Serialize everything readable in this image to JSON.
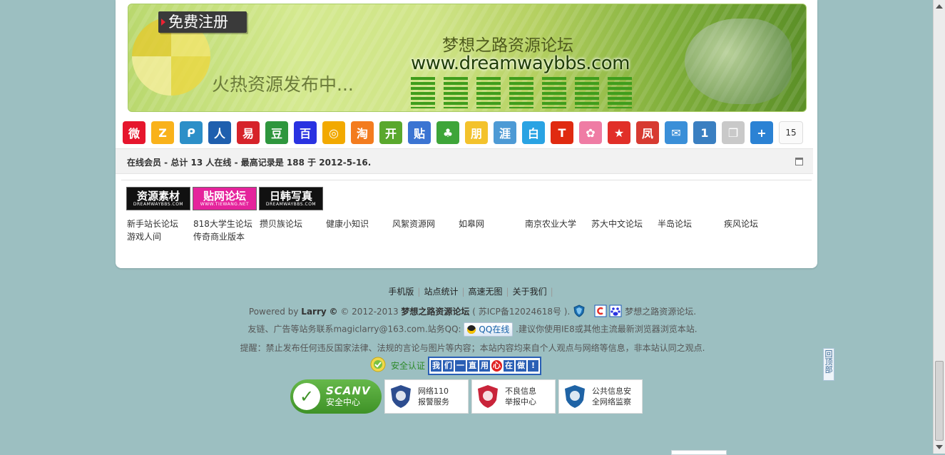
{
  "banner": {
    "register_label": "免费注册",
    "hot_text": "火热资源发布中...",
    "forum_title": "梦想之路资源论坛",
    "forum_url": "www.dreamwaybbs.com"
  },
  "share": {
    "icons": [
      {
        "name": "weibo-icon",
        "glyph": "微",
        "color": "#e6162d"
      },
      {
        "name": "qzone-icon",
        "glyph": "Z",
        "color": "#f9b21b"
      },
      {
        "name": "tencent-weibo-icon",
        "glyph": "ᑭ",
        "color": "#2c8fc8"
      },
      {
        "name": "renren-icon",
        "glyph": "人",
        "color": "#1f5fae"
      },
      {
        "name": "netease-weibo-icon",
        "glyph": "易",
        "color": "#d6232a"
      },
      {
        "name": "douban-icon",
        "glyph": "豆",
        "color": "#2e963d"
      },
      {
        "name": "baidu-icon",
        "glyph": "百",
        "color": "#2932e1"
      },
      {
        "name": "sohu-icon",
        "glyph": "◎",
        "color": "#f2a900"
      },
      {
        "name": "taobao-icon",
        "glyph": "淘",
        "color": "#f37c1f"
      },
      {
        "name": "kaixin-icon",
        "glyph": "开",
        "color": "#5aa82d"
      },
      {
        "name": "tieba-icon",
        "glyph": "贴",
        "color": "#3b74d2"
      },
      {
        "name": "clover-icon",
        "glyph": "♣",
        "color": "#3ea539"
      },
      {
        "name": "pengyou-icon",
        "glyph": "朋",
        "color": "#f3c22c"
      },
      {
        "name": "hexun-icon",
        "glyph": "涯",
        "color": "#4d9ad5"
      },
      {
        "name": "baishehui-icon",
        "glyph": "白",
        "color": "#2aa3e3"
      },
      {
        "name": "tianya-icon",
        "glyph": "T",
        "color": "#e02a10"
      },
      {
        "name": "flower-icon",
        "glyph": "✿",
        "color": "#ef7ca4"
      },
      {
        "name": "star-icon",
        "glyph": "★",
        "color": "#e12f28"
      },
      {
        "name": "ifeng-icon",
        "glyph": "凤",
        "color": "#d73a31"
      },
      {
        "name": "email-icon",
        "glyph": "✉",
        "color": "#3a8fd8"
      },
      {
        "name": "bookmark-icon",
        "glyph": "1",
        "color": "#3a7fc1"
      },
      {
        "name": "copy-icon",
        "glyph": "❐",
        "color": "#c9c9c9"
      },
      {
        "name": "more-icon",
        "glyph": "+",
        "color": "#2b82d4"
      }
    ],
    "count": "15"
  },
  "online": {
    "text": "在线会员 - 总计 13 人在线 - 最高记录是 188 于 2012-5-16."
  },
  "friend_logos": [
    {
      "name": "logo-ziyuansucai",
      "main": "资源素材",
      "sub": "DREAMWAYBBS.COM",
      "bg": "#111111",
      "fg": "#ffffff"
    },
    {
      "name": "logo-tiewang",
      "main": "贴网论坛",
      "sub": "WWW.TIEWANG.NET",
      "bg": "#e5239c",
      "fg": "#ffffff"
    },
    {
      "name": "logo-rihanxiezhen",
      "main": "日韩写真",
      "sub": "DREAMWAYBBS.COM",
      "bg": "#111111",
      "fg": "#ffffff"
    }
  ],
  "friend_links": [
    "新手站长论坛",
    "818大学生论坛",
    "攒贝族论坛",
    "健康小知识",
    "风絮资源网",
    "如皋网",
    "南京农业大学",
    "苏大中文论坛",
    "半岛论坛",
    "疾风论坛",
    "游戏人间",
    "传奇商业版本"
  ],
  "footer": {
    "nav": [
      "手机版",
      "站点统计",
      "高速无图",
      "关于我们"
    ],
    "powered_prefix": "Powered by",
    "powered_by": "Larry",
    "copyright": "© 2012-2013",
    "site_name": "梦想之路资源论坛",
    "icp": "( 苏ICP备12024618号 ).",
    "site_name_plain": "梦想之路资源论坛.",
    "contact_text": "友链、广告等站务联系magiclarry@163.com.站务QQ:",
    "qq_label": "QQ在线",
    "browser_tip": ".建议你使用IE8或其他主流最新浏览器浏览本站.",
    "warning": "提醒：禁止发布任何违反国家法律、法规的言论与图片等内容；本站内容均来自个人观点与网络等信息，非本站认同之观点."
  },
  "security": {
    "label": "安全认证",
    "slogan": [
      "我",
      "们",
      "一",
      "直",
      "用",
      "心",
      "在",
      "做",
      "!"
    ]
  },
  "certs": {
    "scan_title": "SCANV",
    "scan_sub": "安全中心",
    "items": [
      {
        "name": "police-110-cert",
        "lines": [
          "网络110",
          "报警服务"
        ],
        "color": "#2d4d8f"
      },
      {
        "name": "bad-info-report-cert",
        "lines": [
          "不良信息",
          "举报中心"
        ],
        "color": "#c9243a"
      },
      {
        "name": "public-security-cert",
        "lines": [
          "公共信息安",
          "全网络监察"
        ],
        "color": "#1f63a5"
      }
    ]
  },
  "to_top_label": "回顶部"
}
